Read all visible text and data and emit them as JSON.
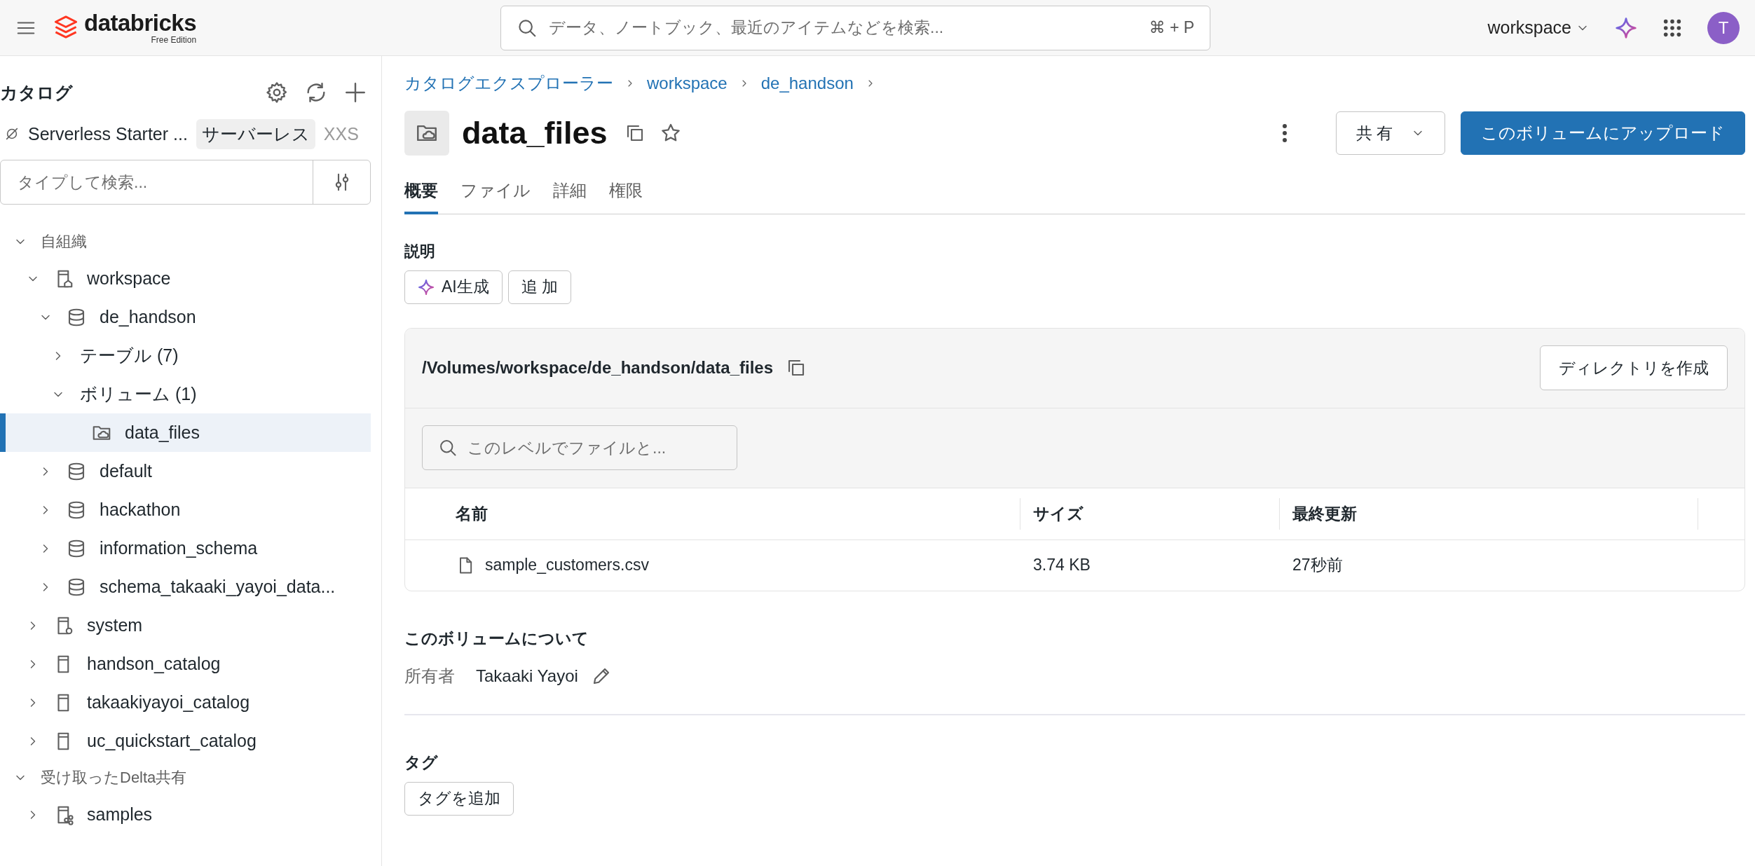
{
  "topbar": {
    "brand": "databricks",
    "brand_sub": "Free Edition",
    "search": {
      "placeholder": "データ、ノートブック、最近のアイテムなどを検索...",
      "shortcut": "⌘ + P"
    },
    "workspace": "workspace",
    "avatar": "T"
  },
  "sidebar": {
    "title": "カタログ",
    "compute": {
      "name": "Serverless Starter ...",
      "badge": "サーバーレス",
      "size": "XXS"
    },
    "search": {
      "placeholder": "タイプして検索..."
    },
    "tree": [
      {
        "label": "自組織",
        "kind": "group",
        "expanded": true,
        "selected": false,
        "children": [
          {
            "label": "workspace",
            "kind": "catalog-home",
            "expanded": true,
            "selected": false,
            "children": [
              {
                "label": "de_handson",
                "kind": "schema",
                "expanded": true,
                "selected": false,
                "children": [
                  {
                    "label": "テーブル (7)",
                    "kind": "folder",
                    "expanded": false,
                    "selected": false
                  },
                  {
                    "label": "ボリューム (1)",
                    "kind": "folder",
                    "expanded": true,
                    "selected": false,
                    "children": [
                      {
                        "label": "data_files",
                        "kind": "volume",
                        "selected": true
                      }
                    ]
                  }
                ]
              },
              {
                "label": "default",
                "kind": "schema",
                "expanded": false,
                "selected": false
              },
              {
                "label": "hackathon",
                "kind": "schema",
                "expanded": false,
                "selected": false
              },
              {
                "label": "information_schema",
                "kind": "schema",
                "expanded": false,
                "selected": false
              },
              {
                "label": "schema_takaaki_yayoi_data...",
                "kind": "schema",
                "expanded": false,
                "selected": false
              }
            ]
          },
          {
            "label": "system",
            "kind": "catalog-system",
            "expanded": false,
            "selected": false
          },
          {
            "label": "handson_catalog",
            "kind": "catalog",
            "expanded": false,
            "selected": false
          },
          {
            "label": "takaakiyayoi_catalog",
            "kind": "catalog",
            "expanded": false,
            "selected": false
          },
          {
            "label": "uc_quickstart_catalog",
            "kind": "catalog",
            "expanded": false,
            "selected": false
          }
        ]
      },
      {
        "label": "受け取ったDelta共有",
        "kind": "group",
        "expanded": true,
        "selected": false,
        "children": [
          {
            "label": "samples",
            "kind": "catalog-shared",
            "expanded": false,
            "selected": false
          }
        ]
      }
    ]
  },
  "main": {
    "breadcrumb": [
      "カタログエクスプローラー",
      "workspace",
      "de_handson"
    ],
    "title": "data_files",
    "share_button": "共 有",
    "upload_button": "このボリュームにアップロード",
    "tabs": [
      {
        "label": "概要",
        "selected": true
      },
      {
        "label": "ファイル",
        "selected": false
      },
      {
        "label": "詳細",
        "selected": false
      },
      {
        "label": "権限",
        "selected": false
      }
    ],
    "description": {
      "label": "説明",
      "ai_button": "AI生成",
      "add_button": "追 加"
    },
    "volume": {
      "path": "/Volumes/workspace/de_handson/data_files",
      "create_dir_button": "ディレクトリを作成",
      "search": {
        "placeholder": "このレベルでファイルと..."
      },
      "columns": [
        "名前",
        "サイズ",
        "最終更新"
      ],
      "rows": [
        {
          "name": "sample_customers.csv",
          "size": "3.74 KB",
          "modified": "27秒前"
        }
      ]
    },
    "about": {
      "heading": "このボリュームについて",
      "owner_label": "所有者",
      "owner": "Takaaki Yayoi"
    },
    "tags": {
      "heading": "タグ",
      "add_button": "タグを追加"
    }
  }
}
